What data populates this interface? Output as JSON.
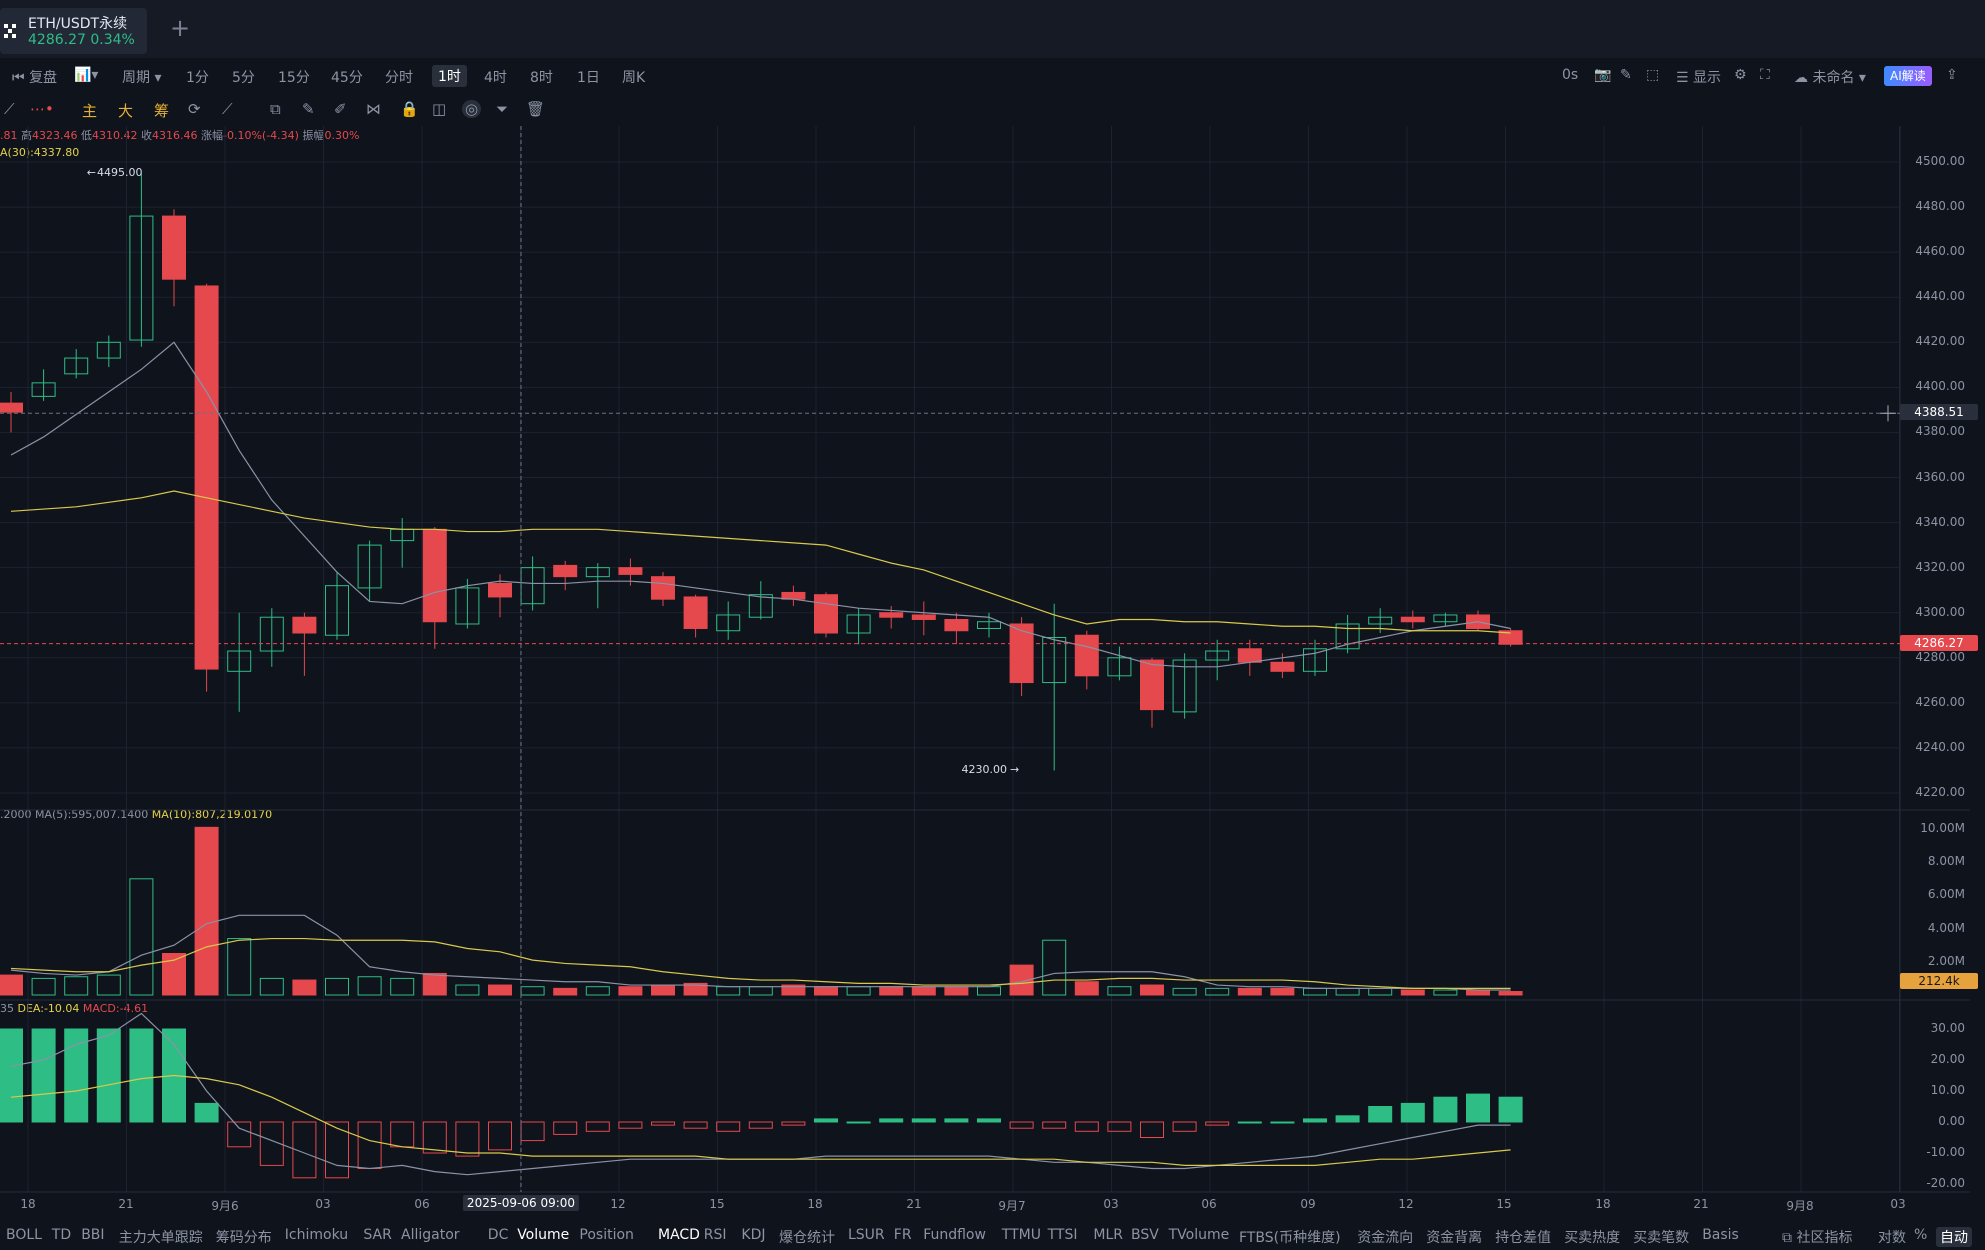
{
  "symbol": {
    "name": "ETH/USDT永续",
    "price": "4286.27",
    "change": "0.34%"
  },
  "toolbar": {
    "replay": "复盘",
    "period": "周期",
    "intervals": [
      "1分",
      "5分",
      "15分",
      "45分",
      "分时",
      "1时",
      "4时",
      "8时",
      "1日",
      "周K"
    ],
    "active_interval": "1时",
    "right": {
      "timer": "0s",
      "display": "显示",
      "layout": "未命名",
      "ai": "AI解读"
    }
  },
  "drawbar": {
    "main": "主",
    "big": "大",
    "chips": "筹"
  },
  "info": {
    "ohlc_open_frag": ".81",
    "high_label": "高",
    "high": "4323.46",
    "low_label": "低",
    "low": "4310.42",
    "close_label": "收",
    "close": "4316.46",
    "chg_label": "涨幅",
    "chg": "-0.10%(-4.34)",
    "amp_label": "振幅",
    "amp": "0.30%",
    "ma30": "A(30):4337.80",
    "vol_frag": ".2000",
    "vol_ma5": "MA(5):595,007.1400",
    "vol_ma10": "MA(10):807,219.0170",
    "macd_frag": "35",
    "dea": "DEA:-10.04",
    "macd": "MACD:-4.61"
  },
  "annotations": {
    "high": "4495.00",
    "low": "4230.00",
    "crosshair_price": "4388.51",
    "last_price": "4286.27",
    "volume_tag": "212.4k",
    "crosshair_time": "2025-09-06 09:00"
  },
  "price_axis": [
    "4500.00",
    "4480.00",
    "4460.00",
    "4440.00",
    "4420.00",
    "4400.00",
    "4380.00",
    "4360.00",
    "4340.00",
    "4320.00",
    "4300.00",
    "4280.00",
    "4260.00",
    "4240.00",
    "4220.00"
  ],
  "volume_axis": [
    "10.00M",
    "8.00M",
    "6.00M",
    "4.00M",
    "2.00M"
  ],
  "macd_axis": [
    "30.00",
    "20.00",
    "10.00",
    "0.00",
    "-10.00",
    "-20.00"
  ],
  "time_axis": [
    "18",
    "21",
    "9月6",
    "03",
    "06",
    "12",
    "15",
    "18",
    "21",
    "9月7",
    "03",
    "06",
    "09",
    "12",
    "15",
    "18",
    "21",
    "9月8",
    "03"
  ],
  "indicators": [
    "BOLL",
    "TD",
    "BBI",
    "主力大单跟踪",
    "筹码分布",
    "Ichimoku",
    "SAR",
    "Alligator",
    "DC",
    "Volume",
    "Position",
    "MACD",
    "RSI",
    "KDJ",
    "爆仓统计",
    "LSUR",
    "FR",
    "Fundflow",
    "TTMU",
    "TTSI",
    "MLR",
    "BSV",
    "TVolume",
    "FTBS(币种维度)",
    "资金流向",
    "资金背离",
    "持仓差值",
    "买卖热度",
    "买卖笔数",
    "Basis"
  ],
  "active_indicators": [
    "Volume",
    "MACD"
  ],
  "bottom_right": {
    "community": "社区指标",
    "log": "对数",
    "pct": "%",
    "auto": "自动"
  },
  "colors": {
    "up": "#2ebd85",
    "down": "#e5484d",
    "ma_yellow": "#d9c94a",
    "ma_gray": "#8a93a6",
    "background": "#0f131c"
  },
  "chart_data": {
    "type": "candlestick",
    "interval": "1h",
    "candles": [
      {
        "o": 4393,
        "h": 4398,
        "l": 4380,
        "c": 4389
      },
      {
        "o": 4396,
        "h": 4408,
        "l": 4394,
        "c": 4402
      },
      {
        "o": 4406,
        "h": 4417,
        "l": 4404,
        "c": 4413
      },
      {
        "o": 4413,
        "h": 4423,
        "l": 4409,
        "c": 4420
      },
      {
        "o": 4421,
        "h": 4495,
        "l": 4418,
        "c": 4476
      },
      {
        "o": 4476,
        "h": 4479,
        "l": 4436,
        "c": 4448
      },
      {
        "o": 4445,
        "h": 4446,
        "l": 4265,
        "c": 4275
      },
      {
        "o": 4274,
        "h": 4300,
        "l": 4256,
        "c": 4283
      },
      {
        "o": 4283,
        "h": 4302,
        "l": 4276,
        "c": 4298
      },
      {
        "o": 4298,
        "h": 4300,
        "l": 4272,
        "c": 4291
      },
      {
        "o": 4290,
        "h": 4318,
        "l": 4288,
        "c": 4312
      },
      {
        "o": 4311,
        "h": 4332,
        "l": 4305,
        "c": 4330
      },
      {
        "o": 4332,
        "h": 4342,
        "l": 4320,
        "c": 4337
      },
      {
        "o": 4337,
        "h": 4338,
        "l": 4284,
        "c": 4296
      },
      {
        "o": 4295,
        "h": 4315,
        "l": 4293,
        "c": 4311
      },
      {
        "o": 4313,
        "h": 4317,
        "l": 4298,
        "c": 4307
      },
      {
        "o": 4304,
        "h": 4325,
        "l": 4301,
        "c": 4320
      },
      {
        "o": 4321,
        "h": 4323,
        "l": 4310,
        "c": 4316
      },
      {
        "o": 4316,
        "h": 4322,
        "l": 4302,
        "c": 4320
      },
      {
        "o": 4320,
        "h": 4324,
        "l": 4312,
        "c": 4317
      },
      {
        "o": 4316,
        "h": 4318,
        "l": 4303,
        "c": 4306
      },
      {
        "o": 4307,
        "h": 4308,
        "l": 4289,
        "c": 4293
      },
      {
        "o": 4292,
        "h": 4305,
        "l": 4288,
        "c": 4299
      },
      {
        "o": 4298,
        "h": 4314,
        "l": 4297,
        "c": 4308
      },
      {
        "o": 4309,
        "h": 4312,
        "l": 4303,
        "c": 4306
      },
      {
        "o": 4308,
        "h": 4309,
        "l": 4289,
        "c": 4291
      },
      {
        "o": 4291,
        "h": 4302,
        "l": 4286,
        "c": 4299
      },
      {
        "o": 4300,
        "h": 4303,
        "l": 4293,
        "c": 4298
      },
      {
        "o": 4299,
        "h": 4305,
        "l": 4290,
        "c": 4297
      },
      {
        "o": 4297,
        "h": 4300,
        "l": 4286,
        "c": 4292
      },
      {
        "o": 4293,
        "h": 4300,
        "l": 4289,
        "c": 4296
      },
      {
        "o": 4295,
        "h": 4298,
        "l": 4263,
        "c": 4269
      },
      {
        "o": 4269,
        "h": 4304,
        "l": 4230,
        "c": 4289
      },
      {
        "o": 4290,
        "h": 4292,
        "l": 4266,
        "c": 4272
      },
      {
        "o": 4272,
        "h": 4285,
        "l": 4270,
        "c": 4280
      },
      {
        "o": 4279,
        "h": 4280,
        "l": 4249,
        "c": 4257
      },
      {
        "o": 4256,
        "h": 4282,
        "l": 4253,
        "c": 4279
      },
      {
        "o": 4279,
        "h": 4288,
        "l": 4270,
        "c": 4283
      },
      {
        "o": 4284,
        "h": 4288,
        "l": 4272,
        "c": 4278
      },
      {
        "o": 4278,
        "h": 4282,
        "l": 4271,
        "c": 4274
      },
      {
        "o": 4274,
        "h": 4288,
        "l": 4272,
        "c": 4284
      },
      {
        "o": 4284,
        "h": 4299,
        "l": 4282,
        "c": 4295
      },
      {
        "o": 4295,
        "h": 4302,
        "l": 4291,
        "c": 4298
      },
      {
        "o": 4298,
        "h": 4301,
        "l": 4293,
        "c": 4296
      },
      {
        "o": 4296,
        "h": 4300,
        "l": 4294,
        "c": 4299
      },
      {
        "o": 4299,
        "h": 4301,
        "l": 4292,
        "c": 4293
      },
      {
        "o": 4292,
        "h": 4293,
        "l": 4285,
        "c": 4286
      }
    ],
    "ma_short": [
      4370,
      4378,
      4388,
      4398,
      4408,
      4420,
      4398,
      4372,
      4350,
      4334,
      4318,
      4305,
      4304,
      4309,
      4312,
      4314,
      4313,
      4313,
      4314,
      4314,
      4313,
      4311,
      4309,
      4307,
      4306,
      4304,
      4302,
      4301,
      4300,
      4299,
      4298,
      4292,
      4288,
      4285,
      4281,
      4277,
      4276,
      4276,
      4278,
      4280,
      4282,
      4286,
      4289,
      4292,
      4294,
      4296,
      4293
    ],
    "ma30": [
      4345,
      4346,
      4347,
      4349,
      4351,
      4354,
      4351,
      4348,
      4345,
      4342,
      4340,
      4338,
      4337,
      4337,
      4336,
      4336,
      4337,
      4337,
      4337,
      4336,
      4335,
      4334,
      4333,
      4332,
      4331,
      4330,
      4326,
      4322,
      4319,
      4314,
      4309,
      4304,
      4299,
      4295,
      4297,
      4297,
      4296,
      4296,
      4295,
      4294,
      4294,
      4293,
      4293,
      4292,
      4292,
      4292,
      4291
    ],
    "volume": [
      1.2,
      1.0,
      1.1,
      1.2,
      7.0,
      2.5,
      10.1,
      3.4,
      1.0,
      0.9,
      1.0,
      1.1,
      1.0,
      1.3,
      0.6,
      0.6,
      0.5,
      0.4,
      0.5,
      0.5,
      0.6,
      0.7,
      0.5,
      0.5,
      0.6,
      0.5,
      0.5,
      0.5,
      0.5,
      0.5,
      0.5,
      1.8,
      3.3,
      0.8,
      0.5,
      0.6,
      0.4,
      0.4,
      0.4,
      0.4,
      0.4,
      0.4,
      0.4,
      0.3,
      0.3,
      0.3,
      0.21
    ],
    "vol_ma5": [
      1.5,
      1.3,
      1.2,
      1.4,
      2.4,
      3.0,
      4.3,
      4.8,
      4.8,
      4.8,
      3.6,
      1.7,
      1.4,
      1.2,
      1.1,
      1.0,
      0.9,
      0.8,
      0.8,
      0.6,
      0.6,
      0.6,
      0.5,
      0.5,
      0.5,
      0.5,
      0.5,
      0.5,
      0.5,
      0.5,
      0.5,
      0.8,
      1.3,
      1.4,
      1.4,
      1.4,
      1.1,
      0.6,
      0.5,
      0.5,
      0.4,
      0.4,
      0.4,
      0.4,
      0.4,
      0.3,
      0.3
    ],
    "vol_ma10": [
      1.6,
      1.5,
      1.4,
      1.4,
      1.8,
      2.1,
      2.9,
      3.3,
      3.4,
      3.4,
      3.3,
      3.3,
      3.3,
      3.2,
      2.8,
      2.6,
      2.1,
      1.9,
      1.8,
      1.7,
      1.4,
      1.2,
      1.0,
      0.9,
      0.9,
      0.8,
      0.7,
      0.7,
      0.6,
      0.6,
      0.6,
      0.7,
      0.9,
      0.9,
      1.0,
      1.0,
      0.9,
      0.9,
      0.9,
      0.9,
      0.8,
      0.6,
      0.5,
      0.4,
      0.4,
      0.4,
      0.4
    ],
    "macd_hist": [
      30,
      30,
      30,
      30,
      30,
      30,
      6,
      -8,
      -14,
      -18,
      -18,
      -15,
      -8,
      -10,
      -11,
      -9,
      -6,
      -4,
      -3,
      -2,
      -1,
      -2,
      -3,
      -2,
      -1,
      1,
      0,
      1,
      1,
      1,
      1,
      -2,
      -2,
      -3,
      -3,
      -5,
      -3,
      -1,
      0,
      0,
      1,
      2,
      5,
      6,
      8,
      9,
      8
    ],
    "macd_dif": [
      18,
      20,
      25,
      28,
      35,
      25,
      10,
      -2,
      -6,
      -10,
      -14,
      -15,
      -14,
      -16,
      -17,
      -16,
      -15,
      -14,
      -13,
      -12,
      -12,
      -12,
      -12,
      -12,
      -12,
      -11,
      -11,
      -11,
      -11,
      -11,
      -11,
      -12,
      -13,
      -13,
      -14,
      -15,
      -15,
      -14,
      -13,
      -12,
      -11,
      -9,
      -7,
      -5,
      -3,
      -1,
      -1
    ],
    "macd_dea": [
      8,
      9,
      10,
      12,
      14,
      15,
      14,
      12,
      8,
      3,
      -2,
      -6,
      -8,
      -9,
      -10,
      -10,
      -11,
      -11,
      -11,
      -11,
      -11,
      -11,
      -12,
      -12,
      -12,
      -12,
      -12,
      -12,
      -12,
      -12,
      -12,
      -12,
      -12,
      -13,
      -13,
      -13,
      -14,
      -14,
      -14,
      -14,
      -14,
      -13,
      -12,
      -12,
      -11,
      -10,
      -9
    ]
  }
}
